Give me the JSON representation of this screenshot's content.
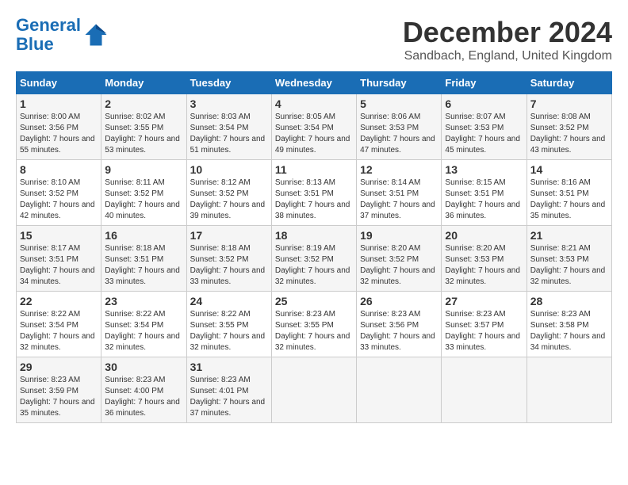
{
  "logo": {
    "line1": "General",
    "line2": "Blue"
  },
  "title": "December 2024",
  "subtitle": "Sandbach, England, United Kingdom",
  "days_of_week": [
    "Sunday",
    "Monday",
    "Tuesday",
    "Wednesday",
    "Thursday",
    "Friday",
    "Saturday"
  ],
  "weeks": [
    [
      {
        "day": "1",
        "sunrise": "8:00 AM",
        "sunset": "3:56 PM",
        "daylight": "7 hours and 55 minutes."
      },
      {
        "day": "2",
        "sunrise": "8:02 AM",
        "sunset": "3:55 PM",
        "daylight": "7 hours and 53 minutes."
      },
      {
        "day": "3",
        "sunrise": "8:03 AM",
        "sunset": "3:54 PM",
        "daylight": "7 hours and 51 minutes."
      },
      {
        "day": "4",
        "sunrise": "8:05 AM",
        "sunset": "3:54 PM",
        "daylight": "7 hours and 49 minutes."
      },
      {
        "day": "5",
        "sunrise": "8:06 AM",
        "sunset": "3:53 PM",
        "daylight": "7 hours and 47 minutes."
      },
      {
        "day": "6",
        "sunrise": "8:07 AM",
        "sunset": "3:53 PM",
        "daylight": "7 hours and 45 minutes."
      },
      {
        "day": "7",
        "sunrise": "8:08 AM",
        "sunset": "3:52 PM",
        "daylight": "7 hours and 43 minutes."
      }
    ],
    [
      {
        "day": "8",
        "sunrise": "8:10 AM",
        "sunset": "3:52 PM",
        "daylight": "7 hours and 42 minutes."
      },
      {
        "day": "9",
        "sunrise": "8:11 AM",
        "sunset": "3:52 PM",
        "daylight": "7 hours and 40 minutes."
      },
      {
        "day": "10",
        "sunrise": "8:12 AM",
        "sunset": "3:52 PM",
        "daylight": "7 hours and 39 minutes."
      },
      {
        "day": "11",
        "sunrise": "8:13 AM",
        "sunset": "3:51 PM",
        "daylight": "7 hours and 38 minutes."
      },
      {
        "day": "12",
        "sunrise": "8:14 AM",
        "sunset": "3:51 PM",
        "daylight": "7 hours and 37 minutes."
      },
      {
        "day": "13",
        "sunrise": "8:15 AM",
        "sunset": "3:51 PM",
        "daylight": "7 hours and 36 minutes."
      },
      {
        "day": "14",
        "sunrise": "8:16 AM",
        "sunset": "3:51 PM",
        "daylight": "7 hours and 35 minutes."
      }
    ],
    [
      {
        "day": "15",
        "sunrise": "8:17 AM",
        "sunset": "3:51 PM",
        "daylight": "7 hours and 34 minutes."
      },
      {
        "day": "16",
        "sunrise": "8:18 AM",
        "sunset": "3:51 PM",
        "daylight": "7 hours and 33 minutes."
      },
      {
        "day": "17",
        "sunrise": "8:18 AM",
        "sunset": "3:52 PM",
        "daylight": "7 hours and 33 minutes."
      },
      {
        "day": "18",
        "sunrise": "8:19 AM",
        "sunset": "3:52 PM",
        "daylight": "7 hours and 32 minutes."
      },
      {
        "day": "19",
        "sunrise": "8:20 AM",
        "sunset": "3:52 PM",
        "daylight": "7 hours and 32 minutes."
      },
      {
        "day": "20",
        "sunrise": "8:20 AM",
        "sunset": "3:53 PM",
        "daylight": "7 hours and 32 minutes."
      },
      {
        "day": "21",
        "sunrise": "8:21 AM",
        "sunset": "3:53 PM",
        "daylight": "7 hours and 32 minutes."
      }
    ],
    [
      {
        "day": "22",
        "sunrise": "8:22 AM",
        "sunset": "3:54 PM",
        "daylight": "7 hours and 32 minutes."
      },
      {
        "day": "23",
        "sunrise": "8:22 AM",
        "sunset": "3:54 PM",
        "daylight": "7 hours and 32 minutes."
      },
      {
        "day": "24",
        "sunrise": "8:22 AM",
        "sunset": "3:55 PM",
        "daylight": "7 hours and 32 minutes."
      },
      {
        "day": "25",
        "sunrise": "8:23 AM",
        "sunset": "3:55 PM",
        "daylight": "7 hours and 32 minutes."
      },
      {
        "day": "26",
        "sunrise": "8:23 AM",
        "sunset": "3:56 PM",
        "daylight": "7 hours and 33 minutes."
      },
      {
        "day": "27",
        "sunrise": "8:23 AM",
        "sunset": "3:57 PM",
        "daylight": "7 hours and 33 minutes."
      },
      {
        "day": "28",
        "sunrise": "8:23 AM",
        "sunset": "3:58 PM",
        "daylight": "7 hours and 34 minutes."
      }
    ],
    [
      {
        "day": "29",
        "sunrise": "8:23 AM",
        "sunset": "3:59 PM",
        "daylight": "7 hours and 35 minutes."
      },
      {
        "day": "30",
        "sunrise": "8:23 AM",
        "sunset": "4:00 PM",
        "daylight": "7 hours and 36 minutes."
      },
      {
        "day": "31",
        "sunrise": "8:23 AM",
        "sunset": "4:01 PM",
        "daylight": "7 hours and 37 minutes."
      },
      null,
      null,
      null,
      null
    ]
  ]
}
